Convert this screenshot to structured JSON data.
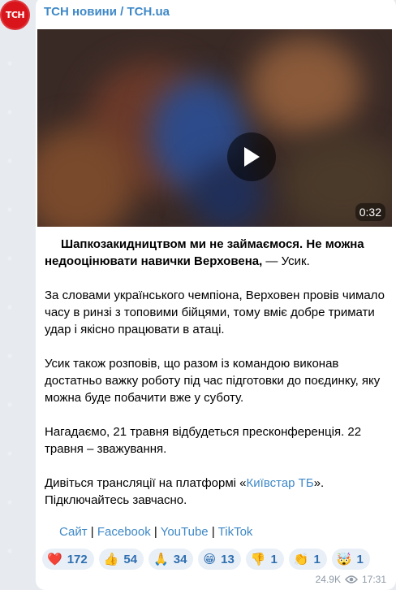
{
  "channel": {
    "avatar_text": "ТСН",
    "name": "ТСН новини / TCH.ua"
  },
  "video": {
    "duration": "0:32"
  },
  "post": {
    "bold_text": "Шапкозакидництвом ми не займаємося. Не можна недооцінювати навички Верховена,",
    "quote_tail": " — Усик.",
    "p2": "За словами українського чемпіона, Верховен провів чимало часу в ринзі з топовими бійцями, тому вміє добре тримати удар і якісно працювати в атаці.",
    "p3": "Усик також розповів, що разом із командою виконав достатньо важку роботу під час підготовки до поєдинку, яку можна буде побачити вже у суботу.",
    "p4": "Нагадаємо, 21 травня відбудеться пресконференція. 22 травня – зважування.",
    "p5_before": "Дивіться трансляції на платформі «",
    "p5_link": "Київстар ТБ",
    "p5_after": "». Підключайтесь завчасно."
  },
  "links": [
    {
      "label": "Сайт"
    },
    {
      "label": "Facebook"
    },
    {
      "label": "YouTube"
    },
    {
      "label": "TikTok"
    }
  ],
  "separator": "|",
  "reactions": [
    {
      "emoji": "❤️",
      "count": "172",
      "icon": "heart-icon"
    },
    {
      "emoji": "👍",
      "count": "54",
      "icon": "thumbs-up-icon"
    },
    {
      "emoji": "🙏",
      "count": "34",
      "icon": "praying-hands-icon"
    },
    {
      "emoji": "😁",
      "count": "13",
      "icon": "grin-icon"
    },
    {
      "emoji": "👎",
      "count": "1",
      "icon": "thumbs-down-icon"
    },
    {
      "emoji": "👏",
      "count": "1",
      "icon": "clapping-icon"
    },
    {
      "emoji": "🤯",
      "count": "1",
      "icon": "mind-blown-icon"
    }
  ],
  "meta": {
    "views": "24.9K",
    "time": "17:31"
  },
  "colors": {
    "accent": "#3e88c7",
    "avatar_bg": "#d9141b"
  }
}
